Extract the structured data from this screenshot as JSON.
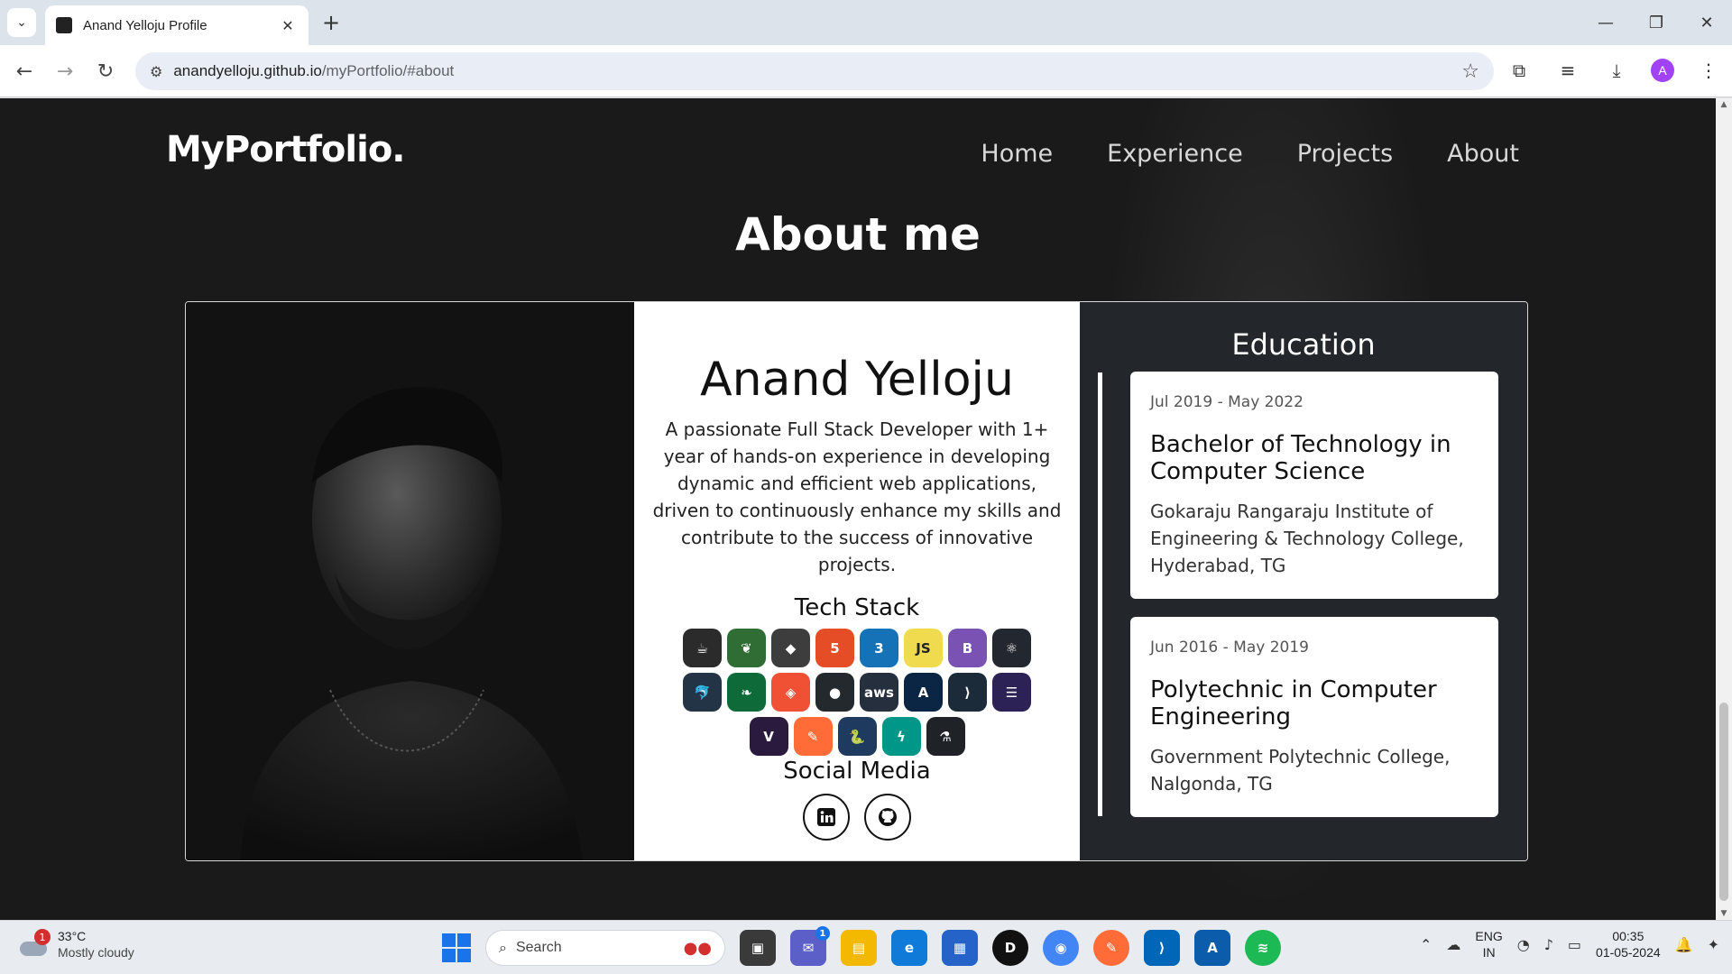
{
  "browser": {
    "tab_title": "Anand Yelloju Profile",
    "url_host": "anandyelloju.github.io",
    "url_path": "/myPortfolio/#about",
    "profile_initial": "A"
  },
  "site": {
    "logo": "MyPortfolio.",
    "nav": [
      "Home",
      "Experience",
      "Projects",
      "About"
    ],
    "section_title": "About me"
  },
  "profile": {
    "name": "Anand Yelloju",
    "bio": "A passionate Full Stack Developer with 1+ year of hands-on experience in developing dynamic and efficient web applications, driven to continuously enhance my skills and contribute to the success of innovative projects.",
    "tech_stack_title": "Tech Stack",
    "tech_stack": [
      {
        "name": "java-icon",
        "glyph": "☕",
        "color": "#2b2b2b"
      },
      {
        "name": "spring-icon",
        "glyph": "❦",
        "color": "#2f6d35"
      },
      {
        "name": "hibernate-icon",
        "glyph": "◆",
        "color": "#3d3d3d"
      },
      {
        "name": "html5-icon",
        "glyph": "5",
        "color": "#e44d26"
      },
      {
        "name": "css3-icon",
        "glyph": "3",
        "color": "#1572b6"
      },
      {
        "name": "javascript-icon",
        "glyph": "JS",
        "color": "#f0db4f"
      },
      {
        "name": "bootstrap-icon",
        "glyph": "B",
        "color": "#7952b3"
      },
      {
        "name": "react-icon",
        "glyph": "⚛",
        "color": "#23272f"
      },
      {
        "name": "mysql-icon",
        "glyph": "🐬",
        "color": "#243447"
      },
      {
        "name": "mongodb-icon",
        "glyph": "❧",
        "color": "#0f6a3a"
      },
      {
        "name": "git-icon",
        "glyph": "◈",
        "color": "#f05033"
      },
      {
        "name": "github-icon",
        "glyph": "●",
        "color": "#24292e"
      },
      {
        "name": "aws-icon",
        "glyph": "aws",
        "color": "#252f3e"
      },
      {
        "name": "azure-icon",
        "glyph": "A",
        "color": "#0b2544"
      },
      {
        "name": "vscode-icon",
        "glyph": "⟩",
        "color": "#1c2b3a"
      },
      {
        "name": "eclipse-icon",
        "glyph": "☰",
        "color": "#2c2255"
      },
      {
        "name": "maven-icon",
        "glyph": "V",
        "color": "#2a1a3d"
      },
      {
        "name": "postman-icon",
        "glyph": "✎",
        "color": "#ff6c37"
      },
      {
        "name": "python-icon",
        "glyph": "🐍",
        "color": "#1e3a5f"
      },
      {
        "name": "fastapi-icon",
        "glyph": "ϟ",
        "color": "#009688"
      },
      {
        "name": "flask-icon",
        "glyph": "⚗",
        "color": "#1f2328"
      }
    ],
    "social_title": "Social Media",
    "social": [
      {
        "name": "linkedin-icon",
        "glyph": "in"
      },
      {
        "name": "github-icon",
        "glyph": "gh"
      }
    ]
  },
  "education": {
    "title": "Education",
    "entries": [
      {
        "dates": "Jul 2019 - May 2022",
        "degree": "Bachelor of Technology in Computer Science",
        "school": "Gokaraju Rangaraju Institute of Engineering & Technology College, Hyderabad, TG"
      },
      {
        "dates": "Jun 2016 - May 2019",
        "degree": "Polytechnic in Computer Engineering",
        "school": "Government Polytechnic College, Nalgonda, TG"
      }
    ]
  },
  "taskbar": {
    "weather_temp": "33°C",
    "weather_desc": "Mostly cloudy",
    "weather_badge": "1",
    "search_label": "Search",
    "chat_badge": "1",
    "lang_top": "ENG",
    "lang_bottom": "IN",
    "time": "00:35",
    "date": "01-05-2024"
  },
  "colors": {
    "page_bg": "#1a1a1a",
    "edu_bg": "#23262b",
    "accent": "#ffffff"
  }
}
